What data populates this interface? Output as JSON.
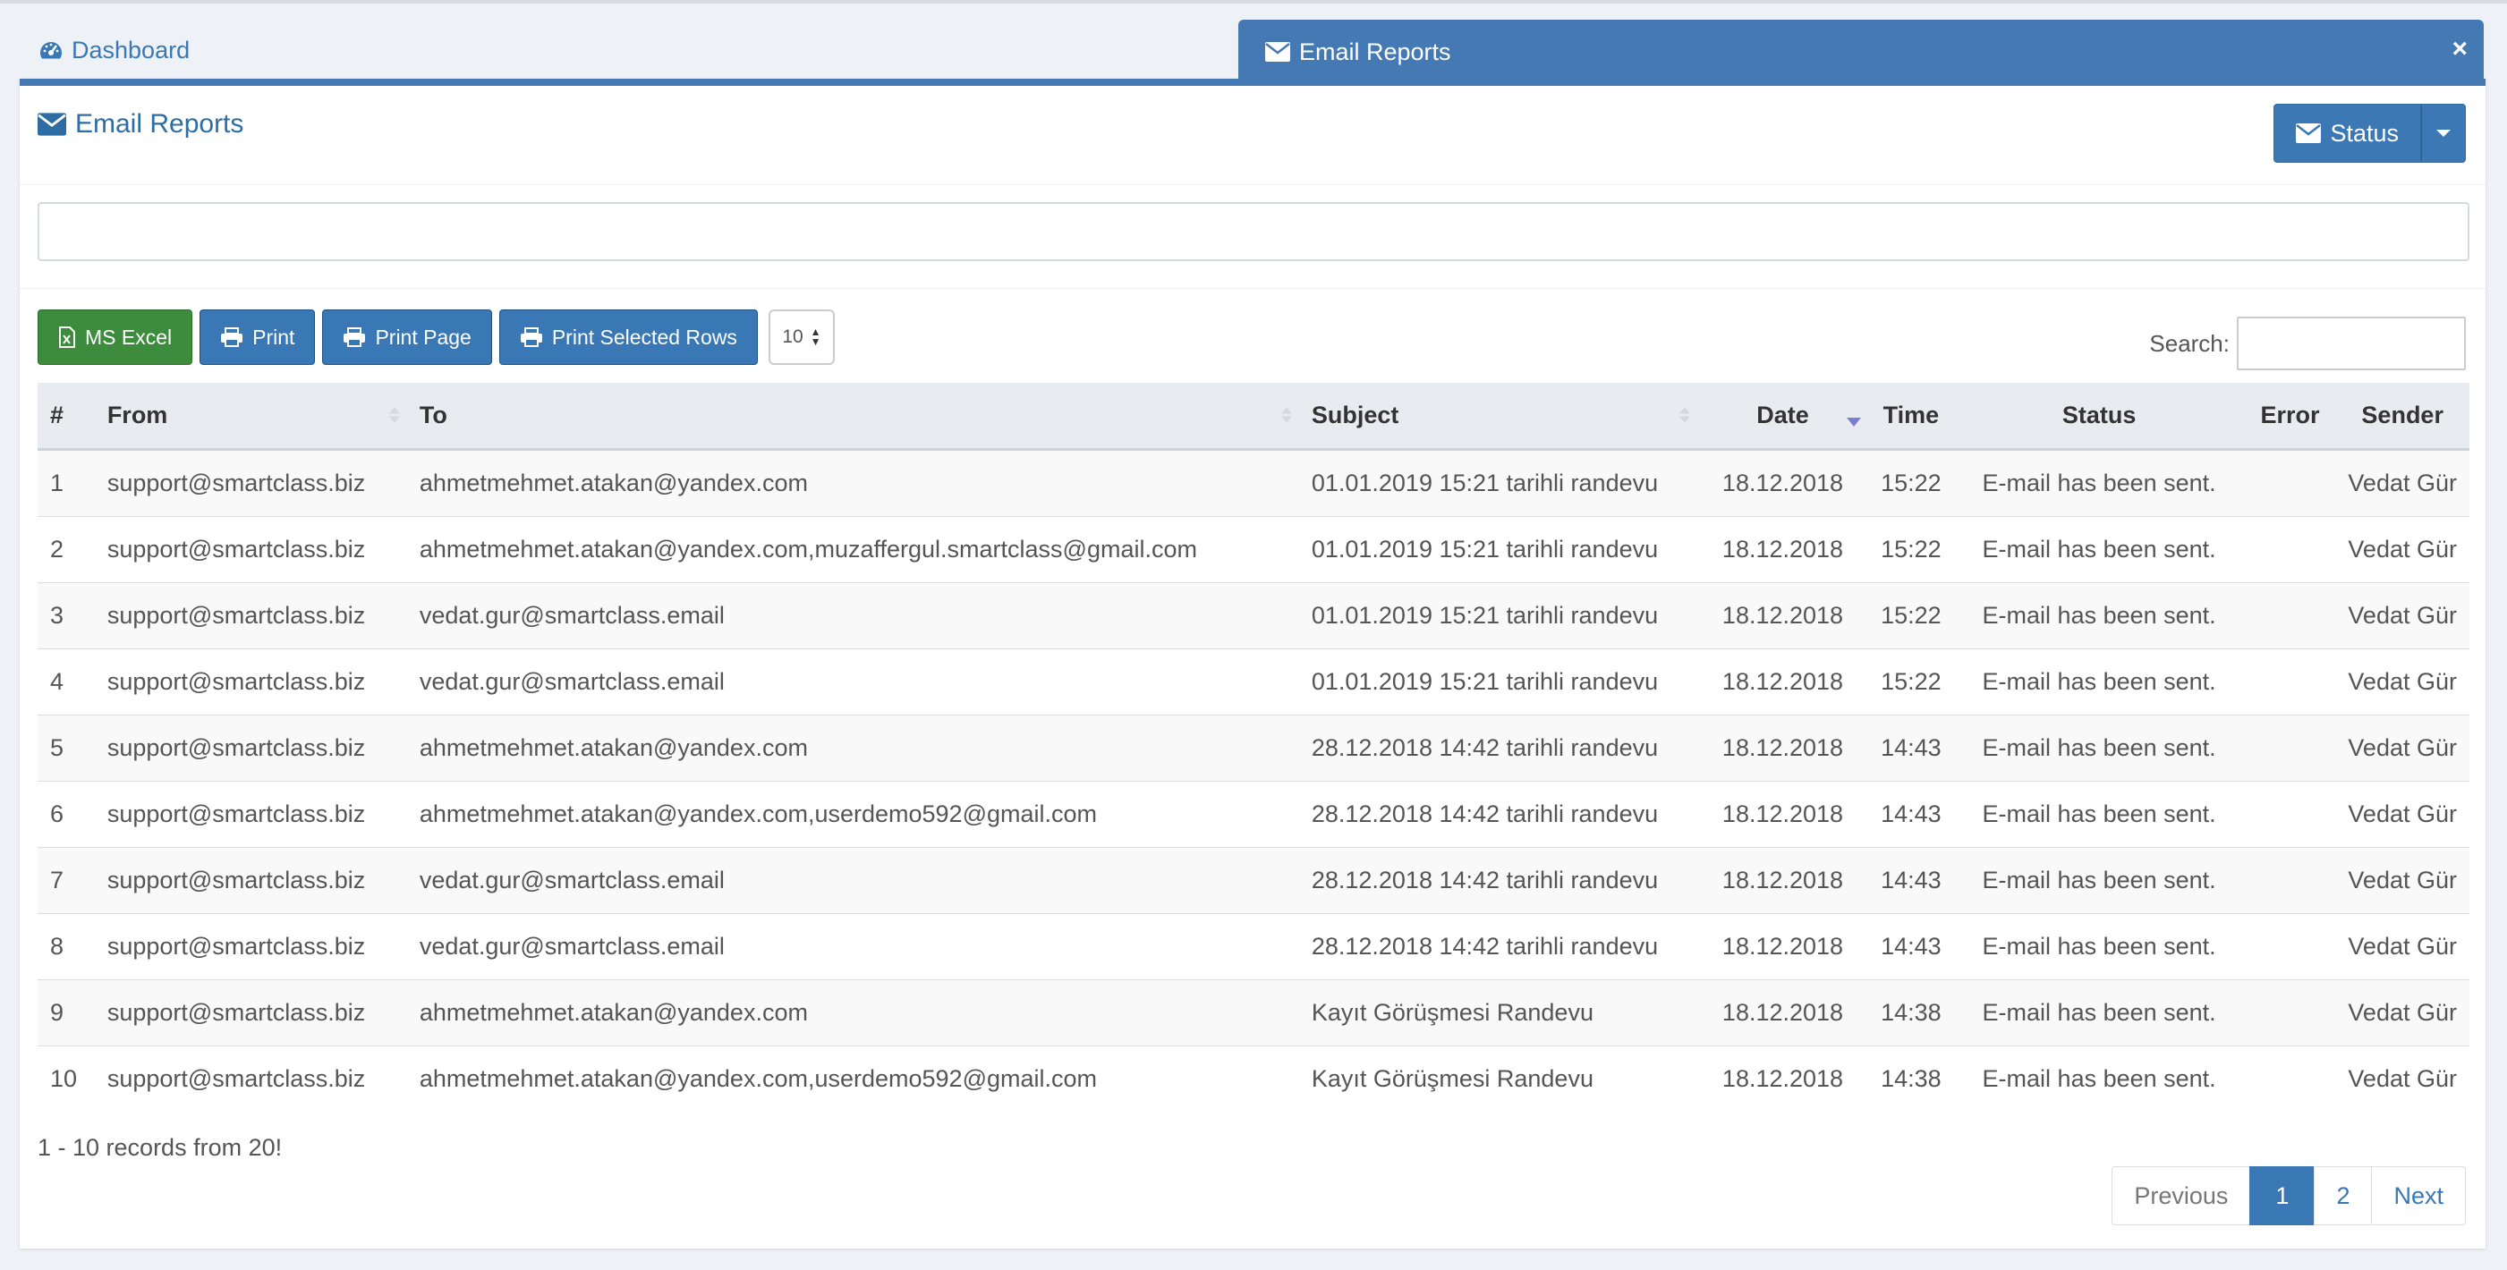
{
  "tabs": {
    "dashboard_label": "Dashboard",
    "active_label": "Email Reports",
    "close_glyph": "×"
  },
  "panel": {
    "title": "Email Reports",
    "status_button": "Status"
  },
  "toolbar": {
    "excel_label": "MS Excel",
    "print_label": "Print",
    "print_page_label": "Print Page",
    "print_selected_label": "Print Selected Rows",
    "page_length_value": "10",
    "search_label": "Search:"
  },
  "table": {
    "columns": [
      "#",
      "From",
      "To",
      "Subject",
      "Date",
      "Time",
      "Status",
      "Error",
      "Sender"
    ],
    "rows": [
      {
        "num": "1",
        "from": "support@smartclass.biz",
        "to": "ahmetmehmet.atakan@yandex.com",
        "subject": "01.01.2019 15:21 tarihli randevu",
        "date": "18.12.2018",
        "time": "15:22",
        "status": "E-mail has been sent.",
        "error": "",
        "sender": "Vedat Gür"
      },
      {
        "num": "2",
        "from": "support@smartclass.biz",
        "to": "ahmetmehmet.atakan@yandex.com,muzaffergul.smartclass@gmail.com",
        "subject": "01.01.2019 15:21 tarihli randevu",
        "date": "18.12.2018",
        "time": "15:22",
        "status": "E-mail has been sent.",
        "error": "",
        "sender": "Vedat Gür"
      },
      {
        "num": "3",
        "from": "support@smartclass.biz",
        "to": "vedat.gur@smartclass.email",
        "subject": "01.01.2019 15:21 tarihli randevu",
        "date": "18.12.2018",
        "time": "15:22",
        "status": "E-mail has been sent.",
        "error": "",
        "sender": "Vedat Gür"
      },
      {
        "num": "4",
        "from": "support@smartclass.biz",
        "to": "vedat.gur@smartclass.email",
        "subject": "01.01.2019 15:21 tarihli randevu",
        "date": "18.12.2018",
        "time": "15:22",
        "status": "E-mail has been sent.",
        "error": "",
        "sender": "Vedat Gür"
      },
      {
        "num": "5",
        "from": "support@smartclass.biz",
        "to": "ahmetmehmet.atakan@yandex.com",
        "subject": "28.12.2018 14:42 tarihli randevu",
        "date": "18.12.2018",
        "time": "14:43",
        "status": "E-mail has been sent.",
        "error": "",
        "sender": "Vedat Gür"
      },
      {
        "num": "6",
        "from": "support@smartclass.biz",
        "to": "ahmetmehmet.atakan@yandex.com,userdemo592@gmail.com",
        "subject": "28.12.2018 14:42 tarihli randevu",
        "date": "18.12.2018",
        "time": "14:43",
        "status": "E-mail has been sent.",
        "error": "",
        "sender": "Vedat Gür"
      },
      {
        "num": "7",
        "from": "support@smartclass.biz",
        "to": "vedat.gur@smartclass.email",
        "subject": "28.12.2018 14:42 tarihli randevu",
        "date": "18.12.2018",
        "time": "14:43",
        "status": "E-mail has been sent.",
        "error": "",
        "sender": "Vedat Gür"
      },
      {
        "num": "8",
        "from": "support@smartclass.biz",
        "to": "vedat.gur@smartclass.email",
        "subject": "28.12.2018 14:42 tarihli randevu",
        "date": "18.12.2018",
        "time": "14:43",
        "status": "E-mail has been sent.",
        "error": "",
        "sender": "Vedat Gür"
      },
      {
        "num": "9",
        "from": "support@smartclass.biz",
        "to": "ahmetmehmet.atakan@yandex.com",
        "subject": "Kayıt Görüşmesi Randevu",
        "date": "18.12.2018",
        "time": "14:38",
        "status": "E-mail has been sent.",
        "error": "",
        "sender": "Vedat Gür"
      },
      {
        "num": "10",
        "from": "support@smartclass.biz",
        "to": "ahmetmehmet.atakan@yandex.com,userdemo592@gmail.com",
        "subject": "Kayıt Görüşmesi Randevu",
        "date": "18.12.2018",
        "time": "14:38",
        "status": "E-mail has been sent.",
        "error": "",
        "sender": "Vedat Gür"
      }
    ]
  },
  "footer": {
    "info_text": "1 - 10 records from 20!",
    "pagination": {
      "previous_label": "Previous",
      "pages": [
        "1",
        "2"
      ],
      "active_page": "1",
      "next_label": "Next"
    }
  },
  "colors": {
    "primary": "#4479b3",
    "excel_green": "#3d8b3d",
    "background": "#eef1f5"
  },
  "icons": {
    "dashboard": "dashboard-icon",
    "envelope": "envelope-icon",
    "excel": "file-excel-icon",
    "print": "print-icon",
    "sort_active": "sort-desc-icon"
  }
}
